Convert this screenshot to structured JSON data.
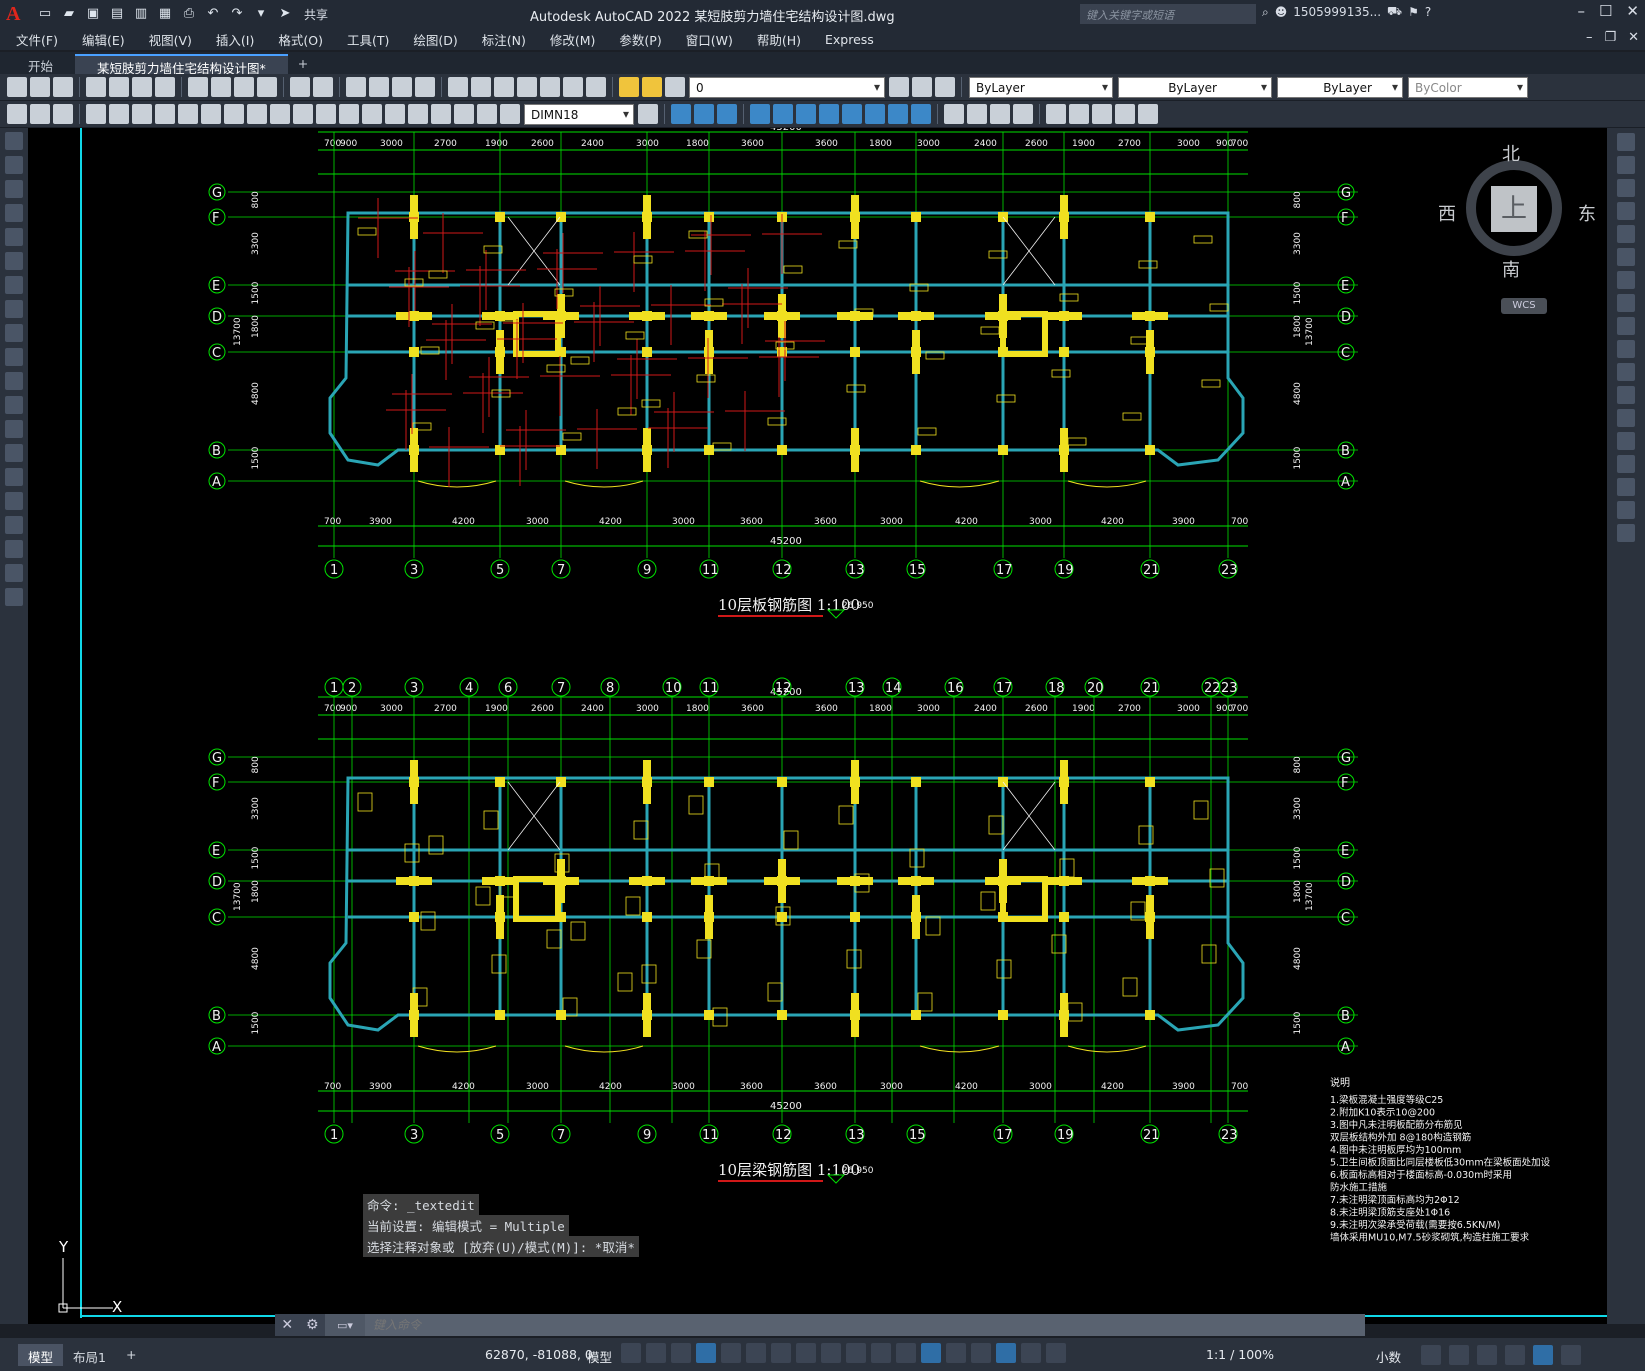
{
  "app": {
    "title": "Autodesk AutoCAD 2022    某短肢剪力墙住宅结构设计图.dwg",
    "logo": "A",
    "share": "共享",
    "search_placeholder": "键入关键字或短语",
    "user": "1505999135...",
    "colors": {
      "accent": "#e0261c",
      "canvas": "#000000"
    }
  },
  "menu": [
    "文件(F)",
    "编辑(E)",
    "视图(V)",
    "插入(I)",
    "格式(O)",
    "工具(T)",
    "绘图(D)",
    "标注(N)",
    "修改(M)",
    "参数(P)",
    "窗口(W)",
    "帮助(H)",
    "Express"
  ],
  "tabs": [
    {
      "label": "开始"
    },
    {
      "label": "某短肢剪力墙住宅结构设计图*"
    },
    {
      "label": "+"
    }
  ],
  "toolbar": {
    "layer": "0",
    "color": "ByLayer",
    "linetype": "ByLayer",
    "lineweight": "ByLayer",
    "plotstyle": "ByColor",
    "dimstyle": "DIMN18"
  },
  "viewcube": {
    "north": "北",
    "south": "南",
    "west": "西",
    "east": "东",
    "face": "上",
    "wcs": "WCS"
  },
  "plan_top": {
    "grid_labels": [
      "1",
      "3",
      "5",
      "7",
      "9",
      "11",
      "12",
      "13",
      "15",
      "17",
      "19",
      "21",
      "23"
    ],
    "row_labels": [
      "G",
      "F",
      "E",
      "D",
      "C",
      "B",
      "A"
    ],
    "top_dims": [
      "700",
      "900",
      "3000",
      "2700",
      "1900",
      "2600",
      "2400",
      "3000",
      "1800",
      "3600",
      "3600",
      "1800",
      "3000",
      "2400",
      "2600",
      "1900",
      "2700",
      "3000",
      "900",
      "700"
    ],
    "bottom_dims": [
      "700",
      "3900",
      "4200",
      "3000",
      "4200",
      "3000",
      "3600",
      "3600",
      "3000",
      "4200",
      "3000",
      "4200",
      "3900",
      "700"
    ],
    "total": "45200",
    "row_dims": [
      "800",
      "3300",
      "1500",
      "1800",
      "4800",
      "1500"
    ],
    "side_total": "13700",
    "title": "10层板钢筋图 1:100",
    "elev": "26.950"
  },
  "plan_bottom": {
    "grid_labels": [
      "1",
      "2",
      "3",
      "4",
      "6",
      "7",
      "8",
      "10",
      "11",
      "12",
      "13",
      "14",
      "16",
      "17",
      "18",
      "20",
      "21",
      "22",
      "23"
    ],
    "bottom_labels": [
      "1",
      "3",
      "5",
      "7",
      "9",
      "11",
      "12",
      "13",
      "15",
      "17",
      "19",
      "21",
      "23"
    ],
    "title": "10层梁钢筋图 1:100",
    "elev": "26.950"
  },
  "notes": {
    "title": "说明",
    "lines": [
      "1.梁板混凝土强度等级C25",
      "2.附加K10表示10@200",
      "3.图中凡未注明板配筋分布筋见",
      "  双层板结构外加 8@180构造钢筋",
      "4.图中未注明板厚均为100mm",
      "5.卫生间板顶面比同层楼板低30mm在梁板面处加设",
      "6.板面标高相对于楼面标高-0.030m时采用",
      "  防水施工措施",
      "7.未注明梁顶面标高均为2Φ12",
      "8.未注明梁顶筋支座处1Φ16",
      "9.未注明次梁承受荷载(需要按6.5KN/M)",
      "  墙体采用MU10,M7.5砂浆砌筑,构造柱施工要求"
    ]
  },
  "command": {
    "history": [
      "命令: _textedit",
      "当前设置: 编辑模式 = Multiple",
      "选择注释对象或 [放弃(U)/模式(M)]: *取消*"
    ],
    "placeholder": "键入命令"
  },
  "ucs": {
    "x": "X",
    "y": "Y"
  },
  "status": {
    "tabs": [
      "模型",
      "布局1",
      "+"
    ],
    "coords": "62870, -81088, 0",
    "space": "模型",
    "scale": "1:1 / 100%",
    "units": "小数"
  }
}
